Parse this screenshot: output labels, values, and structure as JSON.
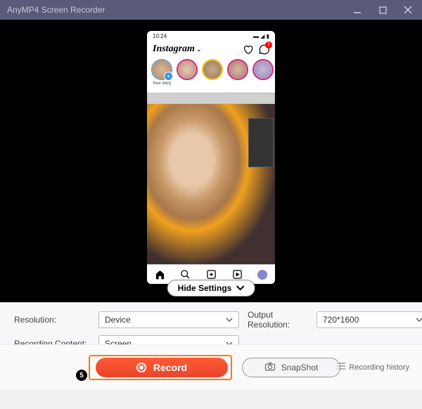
{
  "titlebar": {
    "title": "AnyMP4 Screen Recorder"
  },
  "preview": {
    "hideSettingsLabel": "Hide Settings",
    "phone": {
      "statusTime": "10:24",
      "igLogo": "Instagram",
      "badge": "1",
      "stories": [
        {
          "label": "Your story"
        },
        {
          "label": ""
        },
        {
          "label": ""
        },
        {
          "label": ""
        },
        {
          "label": ""
        }
      ]
    }
  },
  "settings": {
    "resolutionLabel": "Resolution:",
    "resolutionValue": "Device",
    "outputResLabel": "Output Resolution:",
    "outputResValue": "720*1600",
    "recContentLabel": "Recording Content:",
    "recContentValue": "Screen"
  },
  "actions": {
    "step": "5",
    "record": "Record",
    "snapshot": "SnapShot",
    "history": "Recording history"
  }
}
